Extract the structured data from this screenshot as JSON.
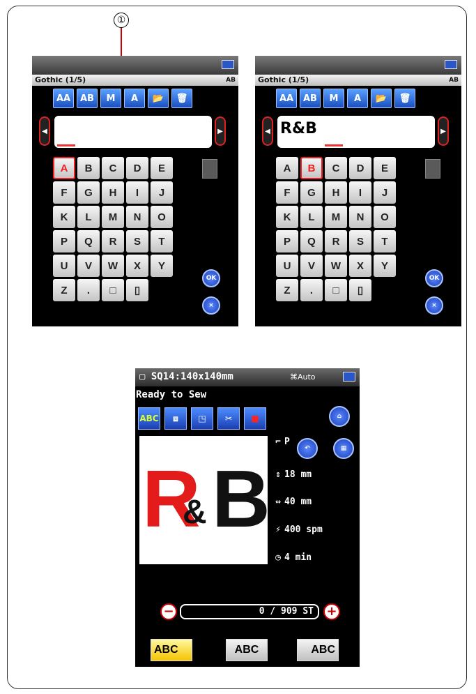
{
  "callout": {
    "number": "①"
  },
  "keyboard_left": {
    "title": "Gothic (1/5)",
    "font_icon": "AB",
    "tools": [
      "AA",
      "AB",
      "M",
      "A",
      "folder",
      "delete"
    ],
    "entry_text": "",
    "keys": [
      "A",
      "B",
      "C",
      "D",
      "E",
      "F",
      "G",
      "H",
      "I",
      "J",
      "K",
      "L",
      "M",
      "N",
      "O",
      "P",
      "Q",
      "R",
      "S",
      "T",
      "U",
      "V",
      "W",
      "X",
      "Y",
      "Z",
      ".",
      "□",
      "▯"
    ],
    "selected_key": "A",
    "ok_label": "OK",
    "cancel_label": "×"
  },
  "keyboard_right": {
    "title": "Gothic (1/5)",
    "font_icon": "AB",
    "tools": [
      "AA",
      "AB",
      "M",
      "A",
      "folder",
      "delete"
    ],
    "entry_text": "R&B",
    "keys": [
      "A",
      "B",
      "C",
      "D",
      "E",
      "F",
      "G",
      "H",
      "I",
      "J",
      "K",
      "L",
      "M",
      "N",
      "O",
      "P",
      "Q",
      "R",
      "S",
      "T",
      "U",
      "V",
      "W",
      "X",
      "Y",
      "Z",
      ".",
      "□",
      "▯"
    ],
    "selected_key": "B",
    "ok_label": "OK",
    "cancel_label": "×"
  },
  "main_screen": {
    "hoop": "SQ14:140x140mm",
    "auto": "Auto",
    "status": "Ready to Sew",
    "tools": [
      "ABC",
      "hoop",
      "trace",
      "auto",
      "color"
    ],
    "preview_text": {
      "r": "R",
      "amp": "&",
      "b": "B"
    },
    "foot": "P",
    "height": "18 mm",
    "width": "40 mm",
    "speed": "400 spm",
    "time": "4 min",
    "stitch_count": "0 / 909 ST",
    "minus": "−",
    "plus": "+",
    "align": [
      "ABC",
      "ABC",
      "ABC"
    ]
  }
}
